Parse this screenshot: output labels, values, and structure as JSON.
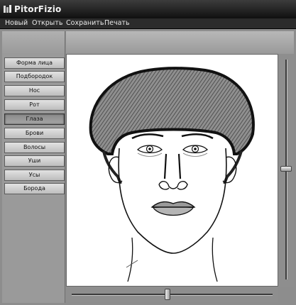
{
  "window": {
    "title": "PitorFizio"
  },
  "menu": [
    "Новый",
    "Открыть",
    "Сохранить",
    "Печать"
  ],
  "sidebar": {
    "items": [
      {
        "label": "Форма лица"
      },
      {
        "label": "Подбородок"
      },
      {
        "label": "Нос"
      },
      {
        "label": "Рот"
      },
      {
        "label": "Глаза",
        "active": true
      },
      {
        "label": "Брови"
      },
      {
        "label": "Волосы"
      },
      {
        "label": "Уши"
      },
      {
        "label": "Усы"
      },
      {
        "label": "Борода"
      }
    ]
  },
  "colors": {
    "titlebar": "#1a1a1a",
    "menubar": "#2b2b2b",
    "panel": "#9a9a9a",
    "canvas": "#ffffff"
  },
  "canvas": {
    "content": "face-composite-sketch"
  }
}
